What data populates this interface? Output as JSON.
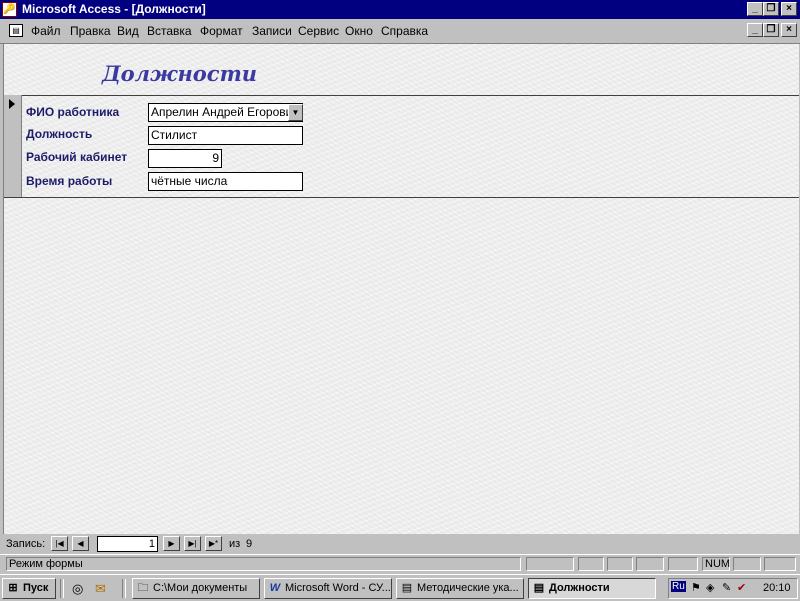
{
  "window": {
    "title": "Microsoft Access - [Должности]",
    "min_glyph": "_",
    "restore_glyph": "❐",
    "close_glyph": "×"
  },
  "menu": {
    "items": [
      "Файл",
      "Правка",
      "Вид",
      "Вставка",
      "Формат",
      "Записи",
      "Сервис",
      "Окно",
      "Справка"
    ],
    "underline": [
      "Ф",
      "П",
      "В",
      "В",
      "Ф",
      "З",
      "С",
      "О",
      "С"
    ]
  },
  "form": {
    "title": "Должности",
    "fields": [
      {
        "label": "ФИО работника",
        "value": "Апрелин Андрей Егорович"
      },
      {
        "label": "Должность",
        "value": "Стилист"
      },
      {
        "label": "Рабочий кабинет",
        "value": "9"
      },
      {
        "label": "Время работы",
        "value": "чётные числа"
      }
    ]
  },
  "navigation": {
    "label": "Запись:",
    "current": "1",
    "of_label": "из",
    "total": "9",
    "first_glyph": "|◀",
    "prev_glyph": "◀",
    "next_glyph": "▶",
    "last_glyph": "▶|",
    "new_glyph": "▶*"
  },
  "status": {
    "mode": "Режим формы",
    "num": "NUM"
  },
  "taskbar": {
    "start": "Пуск",
    "buttons": [
      {
        "label": "C:\\Мои документы",
        "icon": "folder-icon"
      },
      {
        "label": "Microsoft Word - СУ...",
        "icon": "word-icon"
      },
      {
        "label": "Методические ука...",
        "icon": "word-doc-icon"
      },
      {
        "label": "Должности",
        "icon": "access-form-icon"
      }
    ],
    "tray_lang": "Ru",
    "clock": "20:10"
  },
  "colors": {
    "titlebar": "#000080",
    "label_text": "#1c1c6a",
    "form_title": "#3a3aa0",
    "form_background": "#eeeeee"
  }
}
